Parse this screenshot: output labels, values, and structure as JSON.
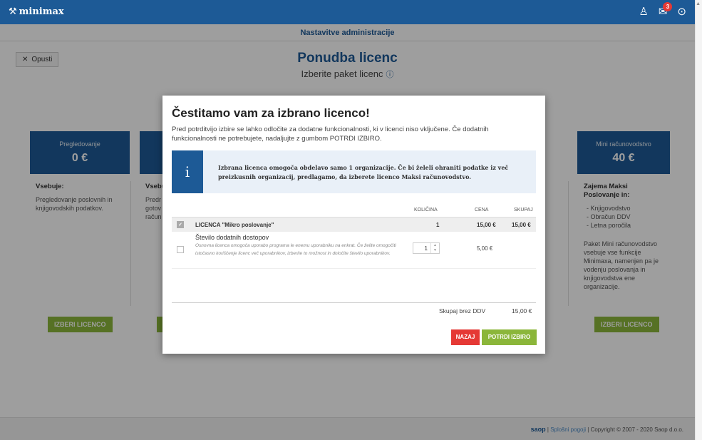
{
  "app": {
    "logo_mark": "⚒",
    "logo_text": "minimax",
    "notifications_count": "3"
  },
  "subbar": {
    "title": "Nastavitve administracije"
  },
  "page": {
    "close_label": "Opusti",
    "title": "Ponudba licenc",
    "subtitle": "Izberite paket licenc",
    "info_glyph": "ⓘ"
  },
  "cards": [
    {
      "name": "Pregledovanje",
      "price": "0 €",
      "body_title": "Vsebuje:",
      "body_text": "Pregledovanje poslovnih in knjigovodskih podatkov.",
      "button": "IZBERI LICENCO"
    },
    {
      "body_title_partial": "Vsebu",
      "lines_partial": [
        "Predr",
        "gotov",
        "račun"
      ]
    },
    {
      "name": "Mini računovodstvo",
      "price": "40 €",
      "body_title": "Zajema Maksi Poslovanje in:",
      "items": [
        "Knjigovodstvo",
        "Obračun DDV",
        "Letna poročila"
      ],
      "body_text": "Paket Mini računovodstvo vsebuje vse funkcije Minimaxa, namenjen pa je vodenju poslovanja in knjigovodstva ene organizacije.",
      "button": "IZBERI LICENCO"
    }
  ],
  "modal": {
    "title": "Čestitamo vam za izbrano licenco!",
    "description": "Pred potrditvijo izbire se lahko odločite za dodatne funkcionalnosti, ki v licenci niso vključene. Če dodatnih funkcionalnosti ne potrebujete, nadaljujte z gumbom POTRDI IZBIRO.",
    "info_icon": "i",
    "info_text": "Izbrana licenca omogoča obdelavo samo 1 organizacije. Če bi želeli ohraniti podatke iz več preizkusnih organizacij, predlagamo, da izberete licenco Maksi računovodstvo.",
    "columns": {
      "quantity": "KOLIČINA",
      "price": "CENA",
      "total": "SKUPAJ"
    },
    "license_row": {
      "name": "LICENCA \"Mikro poslovanje\"",
      "quantity": "1",
      "price": "15,00 €",
      "total": "15,00 €"
    },
    "addon_row": {
      "title": "Število dodatnih dostopov",
      "description": "Osnovna licenca omogoča uporabo programa le enemu uporabniku na enkrat. Če želite omogočiti istočasno koriščenje licenc več uporabnikov, izberite to možnost in določite število uporabnikov.",
      "quantity": "1",
      "price": "5,00 €"
    },
    "total_label": "Skupaj brez DDV",
    "total_value": "15,00 €",
    "back_button": "NAZAJ",
    "confirm_button": "POTRDI IZBIRO"
  },
  "footer": {
    "brand": "saop",
    "separator": "|",
    "terms_link": "Splošni pogoji",
    "copyright": "Copyright © 2007 - 2020 Saop d.o.o."
  }
}
